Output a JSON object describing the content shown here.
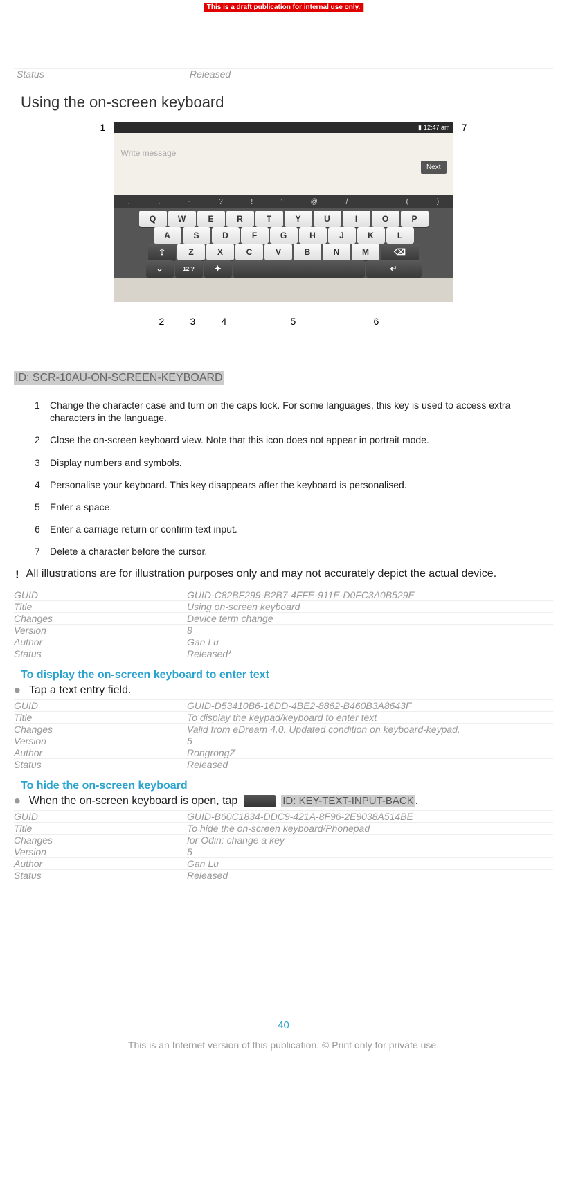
{
  "banner": "This is a draft publication for internal use only.",
  "top_status": {
    "label": "Status",
    "value": "Released"
  },
  "heading": "Using the on-screen keyboard",
  "keyboard": {
    "time": "12:47 am",
    "placeholder": "Write message",
    "next": "Next",
    "symbols": [
      ".",
      ",",
      "-",
      "?",
      "!",
      "'",
      "@",
      "/",
      ":",
      "(",
      ")"
    ],
    "row1": [
      "Q",
      "W",
      "E",
      "R",
      "T",
      "Y",
      "U",
      "I",
      "O",
      "P"
    ],
    "row2": [
      "A",
      "S",
      "D",
      "F",
      "G",
      "H",
      "J",
      "K",
      "L"
    ],
    "row3": [
      "Z",
      "X",
      "C",
      "V",
      "B",
      "N",
      "M"
    ],
    "callouts": {
      "1": "1",
      "2": "2",
      "3": "3",
      "4": "4",
      "5": "5",
      "6": "6",
      "7": "7"
    }
  },
  "image_id": "ID: SCR-10AU-ON-SCREEN-KEYBOARD",
  "items": [
    {
      "n": "1",
      "t": "Change the character case and turn on the caps lock. For some languages, this key is used to access extra characters in the language."
    },
    {
      "n": "2",
      "t": "Close the on-screen keyboard view. Note that this icon does not appear in portrait mode."
    },
    {
      "n": "3",
      "t": "Display numbers and symbols."
    },
    {
      "n": "4",
      "t": "Personalise your keyboard. This key disappears after the keyboard is personalised."
    },
    {
      "n": "5",
      "t": "Enter a space."
    },
    {
      "n": "6",
      "t": "Enter a carriage return or confirm text input."
    },
    {
      "n": "7",
      "t": "Delete a character before the cursor."
    }
  ],
  "notice": "All illustrations are for illustration purposes only and may not accurately depict the actual device.",
  "meta1": [
    {
      "l": "GUID",
      "v": "GUID-C82BF299-B2B7-4FFE-911E-D0FC3A0B529E"
    },
    {
      "l": "Title",
      "v": "Using on-screen keyboard"
    },
    {
      "l": "Changes",
      "v": "Device term change"
    },
    {
      "l": "Version",
      "v": "8"
    },
    {
      "l": "Author",
      "v": "Gan Lu"
    },
    {
      "l": "Status",
      "v": "Released*"
    }
  ],
  "sub1": "To display the on-screen keyboard to enter text",
  "bullet1": "Tap a text entry field.",
  "meta2": [
    {
      "l": "GUID",
      "v": "GUID-D53410B6-16DD-4BE2-8862-B460B3A8643F"
    },
    {
      "l": "Title",
      "v": "To display the keypad/keyboard to enter text"
    },
    {
      "l": "Changes",
      "v": "Valid from eDream 4.0. Updated condition on keyboard-keypad."
    },
    {
      "l": "Version",
      "v": "5"
    },
    {
      "l": "Author",
      "v": "RongrongZ"
    },
    {
      "l": "Status",
      "v": "Released"
    }
  ],
  "sub2": "To hide the on-screen keyboard",
  "bullet2_before": "When the on-screen keyboard is open, tap",
  "bullet2_id": "ID: KEY-TEXT-INPUT-BACK",
  "bullet2_after": ".",
  "meta3": [
    {
      "l": "GUID",
      "v": "GUID-B60C1834-DDC9-421A-8F96-2E9038A514BE"
    },
    {
      "l": "Title",
      "v": "To hide the on-screen keyboard/Phonepad"
    },
    {
      "l": "Changes",
      "v": "for Odin; change a key"
    },
    {
      "l": "Version",
      "v": "5"
    },
    {
      "l": "Author",
      "v": "Gan Lu"
    },
    {
      "l": "Status",
      "v": "Released"
    }
  ],
  "page_number": "40",
  "footer": "This is an Internet version of this publication. © Print only for private use."
}
